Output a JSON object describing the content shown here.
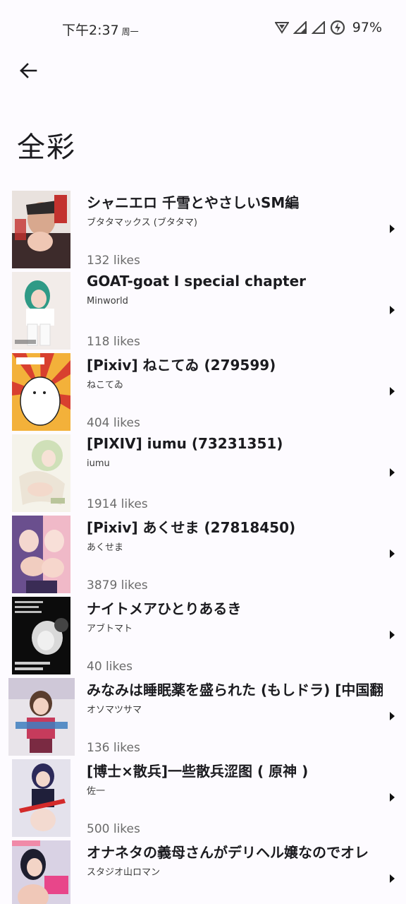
{
  "status_bar": {
    "time": "下午2:37",
    "day": "周一",
    "battery": "97%"
  },
  "header": {
    "title": "全彩"
  },
  "items": [
    {
      "title": "シャニエロ 千雪とやさしいSM編",
      "author": "ブタタマックス (ブタタマ)",
      "likes": "132 likes"
    },
    {
      "title": "GOAT-goat I special chapter",
      "author": "Minworld",
      "likes": "118 likes"
    },
    {
      "title": "[Pixiv] ねこてゐ (279599)",
      "author": "ねこてゐ",
      "likes": "404 likes"
    },
    {
      "title": "[PIXIV] iumu (73231351)",
      "author": "iumu",
      "likes": "1914 likes"
    },
    {
      "title": "[Pixiv] あくせま (27818450)",
      "author": "あくせま",
      "likes": "3879 likes"
    },
    {
      "title": "ナイトメアひとりあるき",
      "author": "アブトマト",
      "likes": "40 likes"
    },
    {
      "title": "みなみは睡眠薬を盛られた (もしドラ) [中国翻",
      "author": "オソマツサマ",
      "likes": "136 likes"
    },
    {
      "title": "[博士×散兵]一些散兵涩图 ( 原神 )",
      "author": "佐一",
      "likes": "500 likes"
    },
    {
      "title": "オナネタの義母さんがデリヘル嬢なのでオレ",
      "author": "スタジオ山ロマン",
      "likes": ""
    }
  ],
  "colors": {
    "background": "#fdfbff",
    "text": "#1b1b1f",
    "muted": "#6b6b6b"
  },
  "icons": [
    "back-arrow-icon",
    "chevron-right-icon",
    "wifi-icon",
    "signal-icon",
    "battery-saver-icon"
  ]
}
